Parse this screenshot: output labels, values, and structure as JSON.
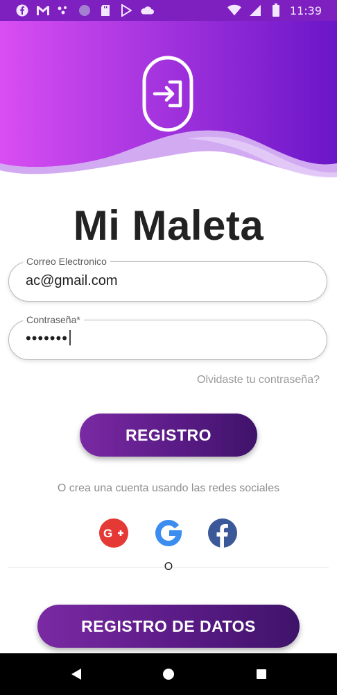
{
  "status_bar": {
    "time": "11:39",
    "left_icons": [
      "facebook-icon",
      "gmail-icon",
      "app-dots-icon",
      "circle-app-icon",
      "sd-card-icon",
      "play-store-icon",
      "cloud-icon"
    ],
    "right_icons": [
      "wifi-icon",
      "signal-icon",
      "battery-icon"
    ]
  },
  "header": {
    "gradient_start": "#d84ef2",
    "gradient_end": "#6a16c8",
    "icon": "login-icon"
  },
  "app": {
    "title": "Mi Maleta"
  },
  "form": {
    "email": {
      "label": "Correo Electronico",
      "value": "ac@gmail.com"
    },
    "password": {
      "label": "Contraseña*",
      "value_masked": "•••••••"
    },
    "forgot_link": "Olvidaste tu contraseña?",
    "register_button": "REGISTRO"
  },
  "social": {
    "text": "O crea una cuenta usando las redes sociales",
    "buttons": [
      {
        "name": "google-plus",
        "color": "#e53935"
      },
      {
        "name": "google",
        "color": "#3b8ef0"
      },
      {
        "name": "facebook",
        "color": "#3b5998"
      }
    ]
  },
  "or_text": "O",
  "data_button": "REGISTRO DE DATOS",
  "colors": {
    "button_gradient": [
      "#7a2aa3",
      "#3f136a"
    ],
    "status_bar": "#7e1fc0"
  },
  "nav": [
    "back-icon",
    "home-icon",
    "recents-icon"
  ]
}
